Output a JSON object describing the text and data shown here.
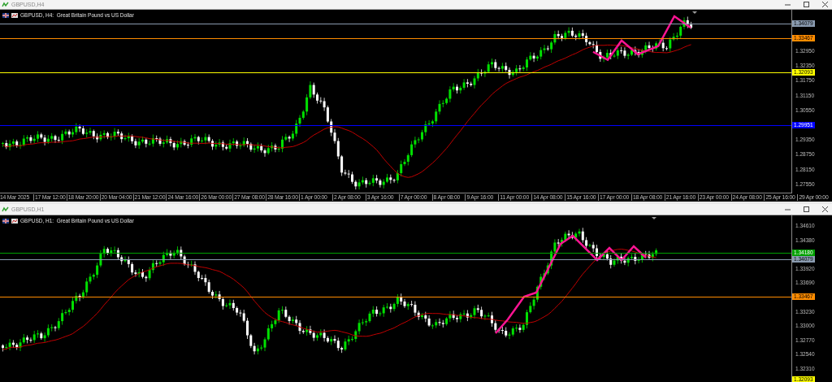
{
  "windows": [
    {
      "title": "GBPUSD,H4",
      "header": "GBPUSD, H4:  Great Britain Pound vs US Dollar",
      "price_ticks": [
        "1.32950",
        "1.32350",
        "1.31750",
        "1.31150",
        "1.30550",
        "1.29350",
        "1.28750",
        "1.28150",
        "1.27550"
      ],
      "levels": [
        {
          "price": "1.34079",
          "color": "#8a9bb0"
        },
        {
          "price": "1.33467",
          "color": "#ff8c00"
        },
        {
          "price": "1.32093",
          "color": "#ffff00"
        },
        {
          "price": "1.29951",
          "color": "#0000ff"
        }
      ],
      "time_ticks": [
        "14 Mar 2025",
        "17 Mar 12:00",
        "18 Mar 20:00",
        "20 Mar 04:00",
        "21 Mar 12:00",
        "24 Mar 16:00",
        "26 Mar 00:00",
        "27 Mar 08:00",
        "28 Mar 16:00",
        "1 Apr 00:00",
        "2 Apr 08:00",
        "3 Apr 16:00",
        "7 Apr 00:00",
        "8 Apr 08:00",
        "9 Apr 16:00",
        "11 Apr 00:00",
        "14 Apr 08:00",
        "15 Apr 16:00",
        "17 Apr 00:00",
        "18 Apr 08:00",
        "21 Apr 16:00",
        "23 Apr 00:00",
        "24 Apr 08:00",
        "25 Apr 16:00",
        "29 Apr 00:00"
      ]
    },
    {
      "title": "GBPUSD,H1",
      "header": "GBPUSD, H1:  Great Britain Pound vs US Dollar",
      "price_ticks": [
        "1.34610",
        "1.34380",
        "1.33920",
        "1.33690",
        "1.33230",
        "1.33000",
        "1.32770",
        "1.32540",
        "1.32310"
      ],
      "levels": [
        {
          "price": "1.34180",
          "color": "#00a000"
        },
        {
          "price": "1.34079",
          "color": "#8a9bb0"
        },
        {
          "price": "1.33467",
          "color": "#ff8c00"
        },
        {
          "price": "1.32093",
          "color": "#ffff00"
        }
      ]
    }
  ]
}
